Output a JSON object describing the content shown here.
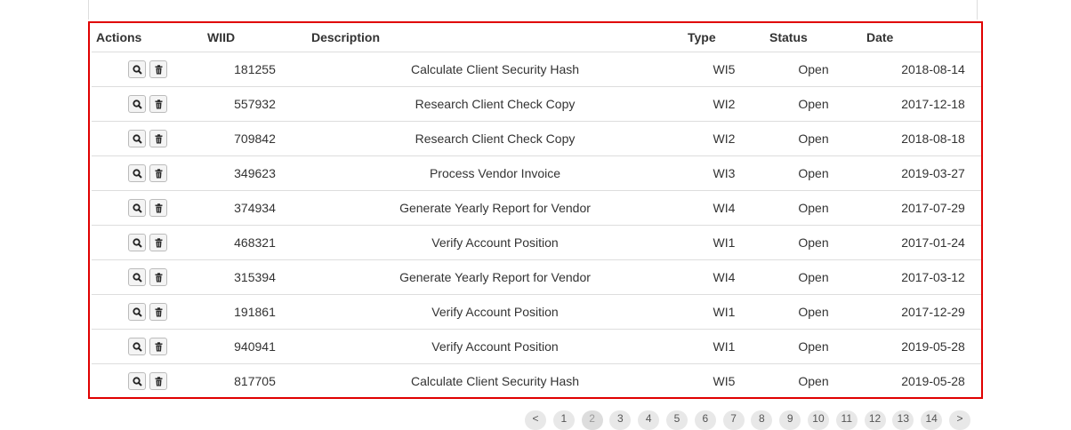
{
  "table": {
    "headers": {
      "actions": "Actions",
      "wiid": "WIID",
      "description": "Description",
      "type": "Type",
      "status": "Status",
      "date": "Date"
    },
    "rows": [
      {
        "wiid": "181255",
        "description": "Calculate Client Security Hash",
        "type": "WI5",
        "status": "Open",
        "date": "2018-08-14"
      },
      {
        "wiid": "557932",
        "description": "Research Client Check Copy",
        "type": "WI2",
        "status": "Open",
        "date": "2017-12-18"
      },
      {
        "wiid": "709842",
        "description": "Research Client Check Copy",
        "type": "WI2",
        "status": "Open",
        "date": "2018-08-18"
      },
      {
        "wiid": "349623",
        "description": "Process Vendor Invoice",
        "type": "WI3",
        "status": "Open",
        "date": "2019-03-27"
      },
      {
        "wiid": "374934",
        "description": "Generate Yearly Report for Vendor",
        "type": "WI4",
        "status": "Open",
        "date": "2017-07-29"
      },
      {
        "wiid": "468321",
        "description": "Verify Account Position",
        "type": "WI1",
        "status": "Open",
        "date": "2017-01-24"
      },
      {
        "wiid": "315394",
        "description": "Generate Yearly Report for Vendor",
        "type": "WI4",
        "status": "Open",
        "date": "2017-03-12"
      },
      {
        "wiid": "191861",
        "description": "Verify Account Position",
        "type": "WI1",
        "status": "Open",
        "date": "2017-12-29"
      },
      {
        "wiid": "940941",
        "description": "Verify Account Position",
        "type": "WI1",
        "status": "Open",
        "date": "2019-05-28"
      },
      {
        "wiid": "817705",
        "description": "Calculate Client Security Hash",
        "type": "WI5",
        "status": "Open",
        "date": "2019-05-28"
      }
    ],
    "row_actions": {
      "view_icon": "search-icon",
      "delete_icon": "trash-icon"
    }
  },
  "pagination": {
    "prev": "<",
    "pages": [
      "1",
      "2",
      "3",
      "4",
      "5",
      "6",
      "7",
      "8",
      "9",
      "10",
      "11",
      "12",
      "13",
      "14"
    ],
    "next": ">",
    "current": "2"
  },
  "colors": {
    "highlight_border": "#e00000",
    "row_divider": "#dddddd",
    "text": "#333333"
  }
}
